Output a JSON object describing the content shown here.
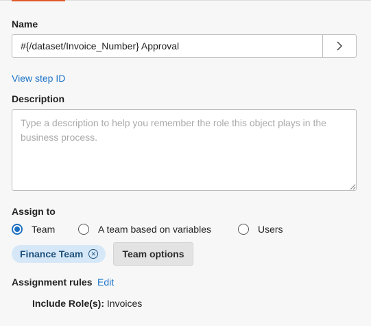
{
  "name_section": {
    "label": "Name",
    "value": "#{/dataset/Invoice_Number} Approval",
    "expand_icon": "chevron-right-icon"
  },
  "view_step_id": "View step ID",
  "description": {
    "label": "Description",
    "placeholder": "Type a description to help you remember the role this object plays in the business process.",
    "value": ""
  },
  "assign_to": {
    "label": "Assign to",
    "options": [
      {
        "label": "Team",
        "checked": true
      },
      {
        "label": "A team based on variables",
        "checked": false
      },
      {
        "label": "Users",
        "checked": false
      }
    ],
    "selected_team": "Finance Team",
    "remove_icon": "circle-x-icon",
    "team_options_label": "Team options"
  },
  "assignment_rules": {
    "label": "Assignment rules",
    "edit_label": "Edit",
    "rule_key": "Include Role(s):",
    "rule_value": "Invoices"
  },
  "colors": {
    "accent_link": "#1a73c8",
    "radio_selected": "#1a6fc0",
    "pill_bg": "#d6e8f8",
    "tab_indicator": "#e05a2b"
  }
}
